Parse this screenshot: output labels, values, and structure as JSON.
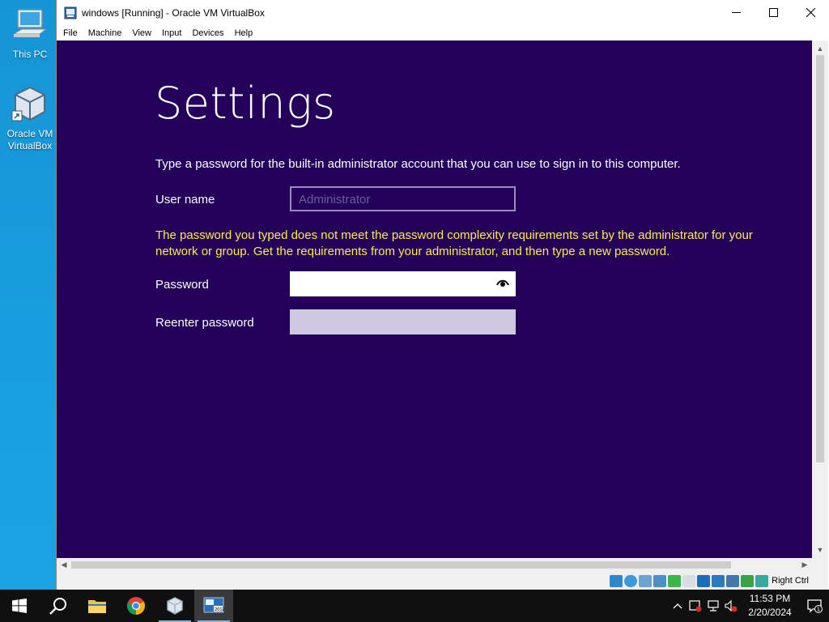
{
  "desktop": {
    "icons": [
      {
        "label": "This PC"
      },
      {
        "label": "Oracle VM VirtualBox"
      }
    ]
  },
  "window": {
    "title": "windows [Running] - Oracle VM VirtualBox",
    "menu": [
      "File",
      "Machine",
      "View",
      "Input",
      "Devices",
      "Help"
    ],
    "host_key_label": "Right Ctrl"
  },
  "guest": {
    "heading": "Settings",
    "instruction": "Type a password for the built-in administrator account that you can use to sign in to this computer.",
    "username_label": "User name",
    "username_value": "Administrator",
    "error_message": "The password you typed does not meet the password complexity requirements set by the administrator for your network or group. Get the requirements from your administrator, and then type a new password.",
    "password_label": "Password",
    "password_value": "",
    "reenter_label": "Reenter password",
    "reenter_value": "",
    "background_color": "#23005a",
    "error_color": "#ffe94f"
  },
  "taskbar": {
    "buttons": [
      "start-icon",
      "search-icon",
      "file-explorer-icon",
      "chrome-icon",
      "virtualbox-icon",
      "vm-2012-icon"
    ],
    "time": "11:53 PM",
    "date": "2/20/2024",
    "notification_count": "1"
  }
}
